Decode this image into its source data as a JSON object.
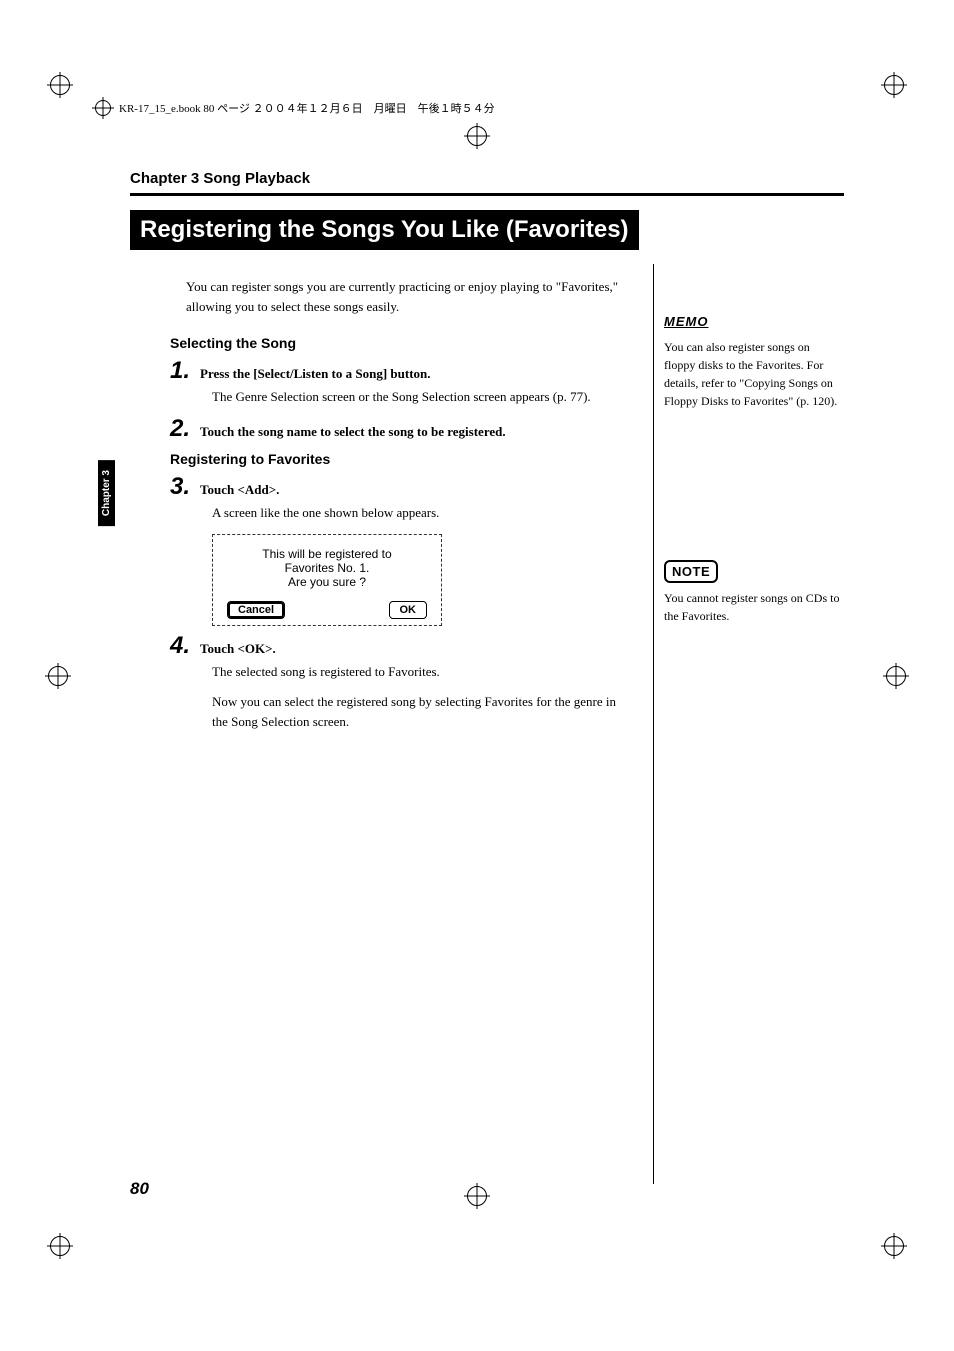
{
  "print_header": "KR-17_15_e.book  80 ページ  ２００４年１２月６日　月曜日　午後１時５４分",
  "chapter_head": "Chapter 3 Song Playback",
  "title": "Registering the Songs You Like (Favorites)",
  "intro": "You can register songs you are currently practicing or enjoy playing to \"Favorites,\" allowing you to select these songs easily.",
  "subhead_select": "Selecting the Song",
  "step1": {
    "num": "1.",
    "text": "Press the [Select/Listen to a Song] button.",
    "body": "The Genre Selection screen or the Song Selection screen appears (p. 77)."
  },
  "step2": {
    "num": "2.",
    "text": "Touch the song name to select the song to be registered."
  },
  "subhead_reg": "Registering to Favorites",
  "step3": {
    "num": "3.",
    "text": "Touch <Add>.",
    "body": "A screen like the one shown below appears."
  },
  "dialog": {
    "line1": "This will be registered to",
    "line2": "Favorites No. 1.",
    "line3": "Are you sure ?",
    "cancel": "Cancel",
    "ok": "OK"
  },
  "step4": {
    "num": "4.",
    "text": "Touch <OK>.",
    "body1": "The selected song is registered to Favorites.",
    "body2": "Now you can select the registered song by selecting Favorites for the genre in the Song Selection screen."
  },
  "sidebar": {
    "memo_label": "MEMO",
    "memo_text": "You can also register songs on floppy disks to the Favorites. For details, refer to \"Copying Songs on Floppy Disks to Favorites\" (p. 120).",
    "note_label": "NOTE",
    "note_text": "You cannot register songs on CDs to the Favorites."
  },
  "vert_tab": "Chapter 3",
  "page_number": "80"
}
